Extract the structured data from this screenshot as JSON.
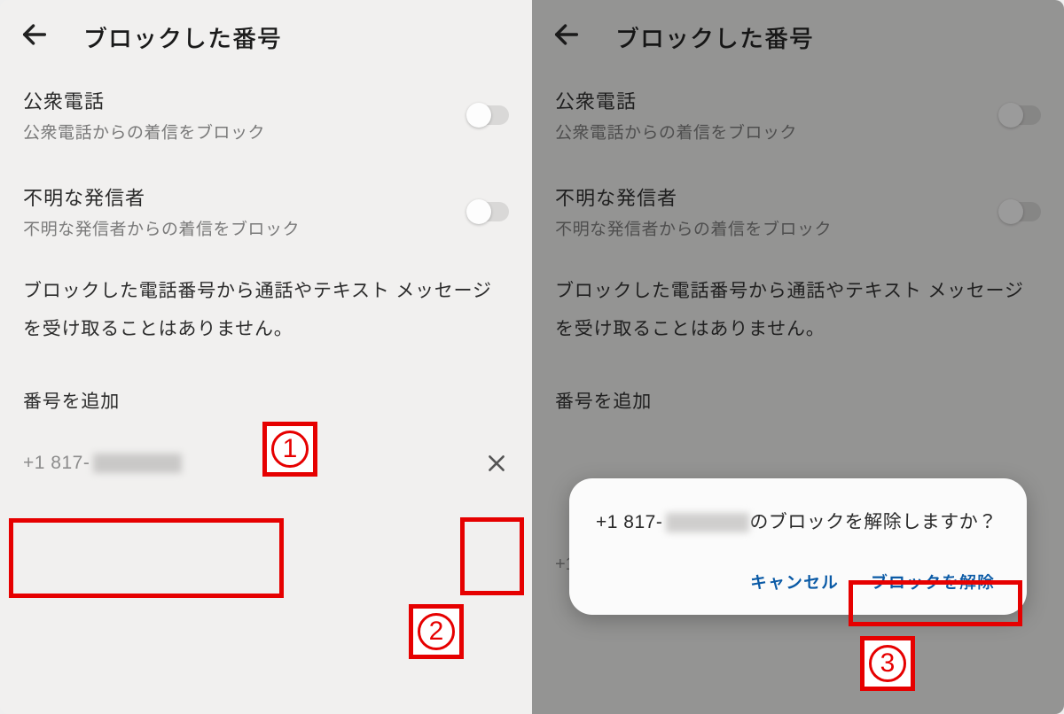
{
  "left": {
    "title": "ブロックした番号",
    "settings": [
      {
        "title": "公衆電話",
        "sub": "公衆電話からの着信をブロック"
      },
      {
        "title": "不明な発信者",
        "sub": "不明な発信者からの着信をブロック"
      }
    ],
    "info": "ブロックした電話番号から通話やテキスト メッセージを受け取ることはありません。",
    "add_label": "番号を追加",
    "number_prefix": "+1 817-"
  },
  "right": {
    "title": "ブロックした番号",
    "settings": [
      {
        "title": "公衆電話",
        "sub": "公衆電話からの着信をブロック"
      },
      {
        "title": "不明な発信者",
        "sub": "不明な発信者からの着信をブロック"
      }
    ],
    "info": "ブロックした電話番号から通話やテキスト メッセージを受け取ることはありません。",
    "add_label": "番号を追加",
    "peek": "+1",
    "dialog": {
      "prefix": "+1 817-",
      "suffix": " のブロックを解除しますか？",
      "cancel": "キャンセル",
      "confirm": "ブロックを解除"
    }
  },
  "markers": {
    "m1": "1",
    "m2": "2",
    "m3": "3"
  }
}
